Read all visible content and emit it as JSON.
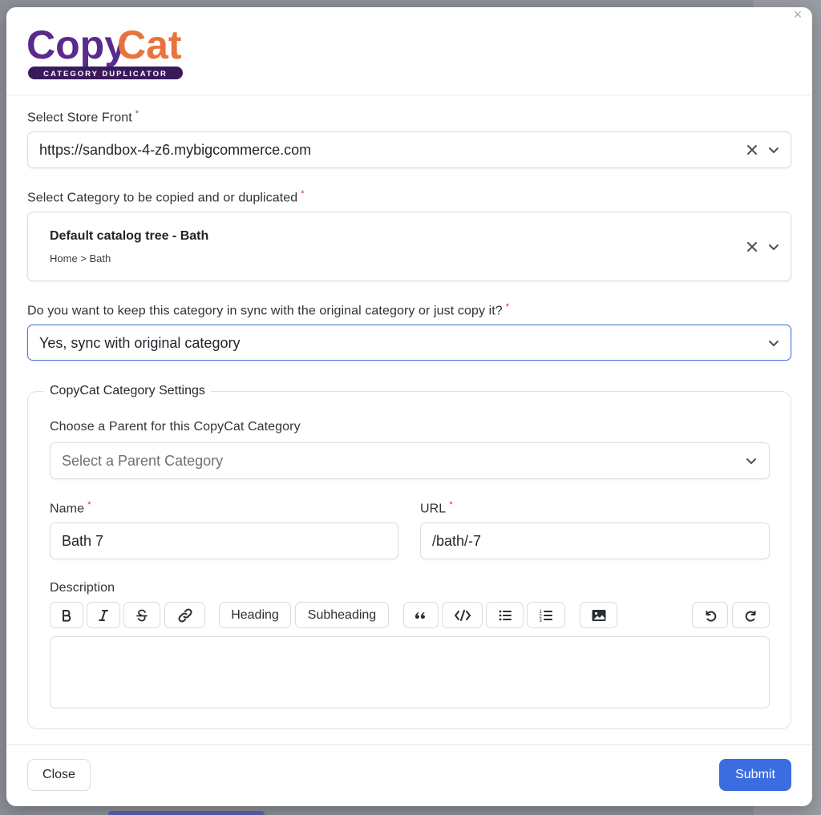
{
  "logo": {
    "brand": "CopyCat",
    "tagline": "CATEGORY DUPLICATOR"
  },
  "colors": {
    "primary": "#3b6de0",
    "required": "#d62d2d",
    "logo_purple": "#5a2a8c",
    "logo_orange": "#e8743b"
  },
  "store_front": {
    "label": "Select Store Front",
    "value": "https://sandbox-4-z6.mybigcommerce.com"
  },
  "category": {
    "label": "Select Category to be copied and or duplicated",
    "title": "Default catalog tree - Bath",
    "path": "Home > Bath"
  },
  "sync": {
    "label": "Do you want to keep this category in sync with the original category or just copy it?",
    "value": "Yes, sync with original category"
  },
  "settings": {
    "legend": "CopyCat Category Settings",
    "parent_label": "Choose a Parent for this CopyCat Category",
    "parent_placeholder": "Select a Parent Category",
    "name_label": "Name",
    "name_value": "Bath 7",
    "url_label": "URL",
    "url_value": "/bath/-7",
    "description_label": "Description",
    "toolbar": {
      "heading": "Heading",
      "subheading": "Subheading"
    },
    "description_value": ""
  },
  "footer": {
    "close_label": "Close",
    "submit_label": "Submit"
  },
  "icons": [
    "close-icon",
    "clear-icon",
    "chevron-down-icon",
    "bold-icon",
    "italic-icon",
    "strikethrough-icon",
    "link-icon",
    "quote-icon",
    "code-icon",
    "bullet-list-icon",
    "ordered-list-icon",
    "image-icon",
    "undo-icon",
    "redo-icon"
  ]
}
